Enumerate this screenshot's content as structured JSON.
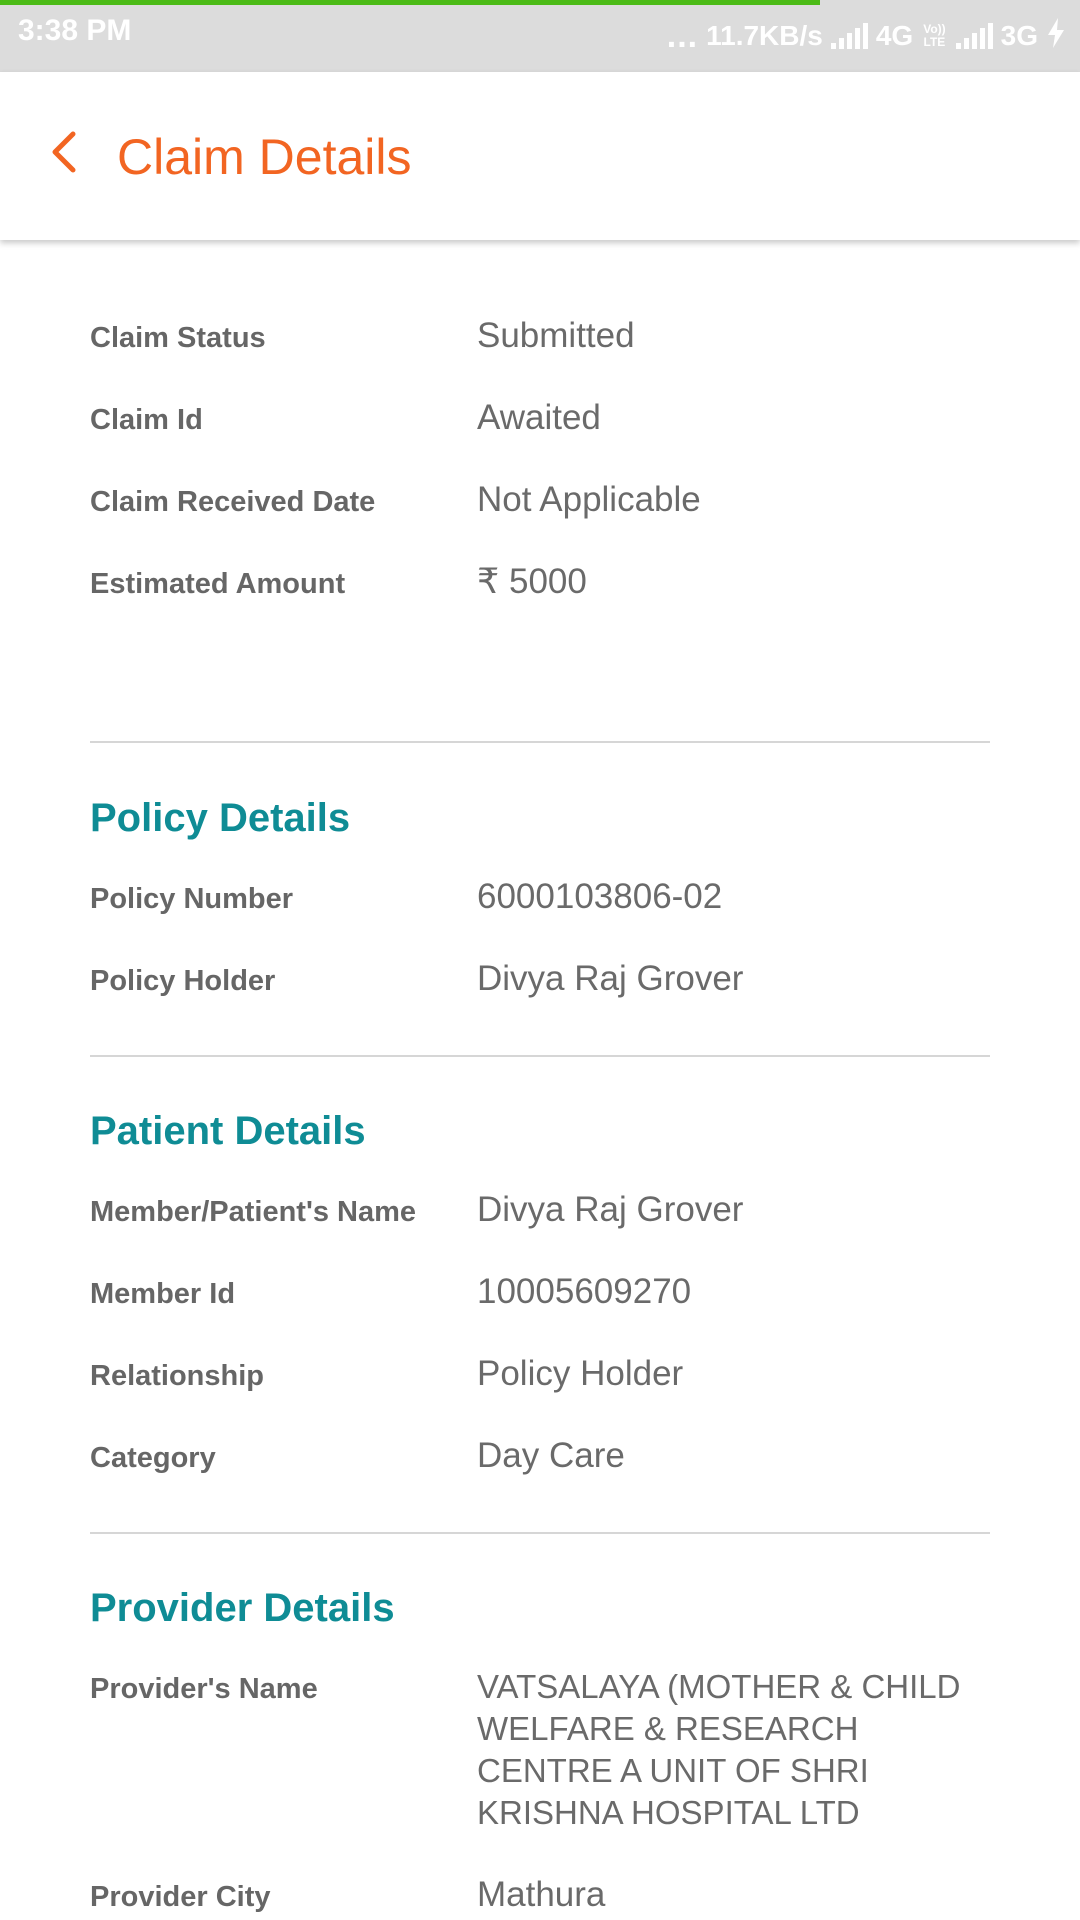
{
  "status_bar": {
    "time": "3:38 PM",
    "dots": "...",
    "speed": "11.7KB/s",
    "network1": "4G",
    "volte_top": "Vo))",
    "volte_bottom": "LTE",
    "network2": "3G",
    "progress_color": "#4cbb17"
  },
  "header": {
    "title": "Claim Details",
    "back_icon": "chevron-left-icon",
    "accent": "#f26522"
  },
  "claim": {
    "rows": [
      {
        "label": "Claim Status",
        "value": "Submitted"
      },
      {
        "label": "Claim Id",
        "value": "Awaited"
      },
      {
        "label": "Claim Received Date",
        "value": "Not Applicable"
      },
      {
        "label": "Estimated Amount",
        "value": "₹ 5000"
      }
    ]
  },
  "policy": {
    "title": "Policy Details",
    "rows": [
      {
        "label": "Policy Number",
        "value": "6000103806-02"
      },
      {
        "label": "Policy Holder",
        "value": "Divya Raj Grover"
      }
    ]
  },
  "patient": {
    "title": "Patient Details",
    "rows": [
      {
        "label": "Member/Patient's Name",
        "value": "Divya Raj Grover"
      },
      {
        "label": "Member Id",
        "value": "10005609270"
      },
      {
        "label": "Relationship",
        "value": "Policy Holder"
      },
      {
        "label": "Category",
        "value": "Day Care"
      }
    ]
  },
  "provider": {
    "title": "Provider Details",
    "rows": [
      {
        "label": "Provider's Name",
        "value": "VATSALAYA (MOTHER & CHILD WELFARE & RESEARCH CENTRE A UNIT OF SHRI KRISHNA HOSPITAL LTD"
      },
      {
        "label": "Provider City",
        "value": "Mathura"
      }
    ]
  },
  "colors": {
    "section_title": "#0f8c95",
    "label": "#666666",
    "value": "#6a6a6a"
  }
}
